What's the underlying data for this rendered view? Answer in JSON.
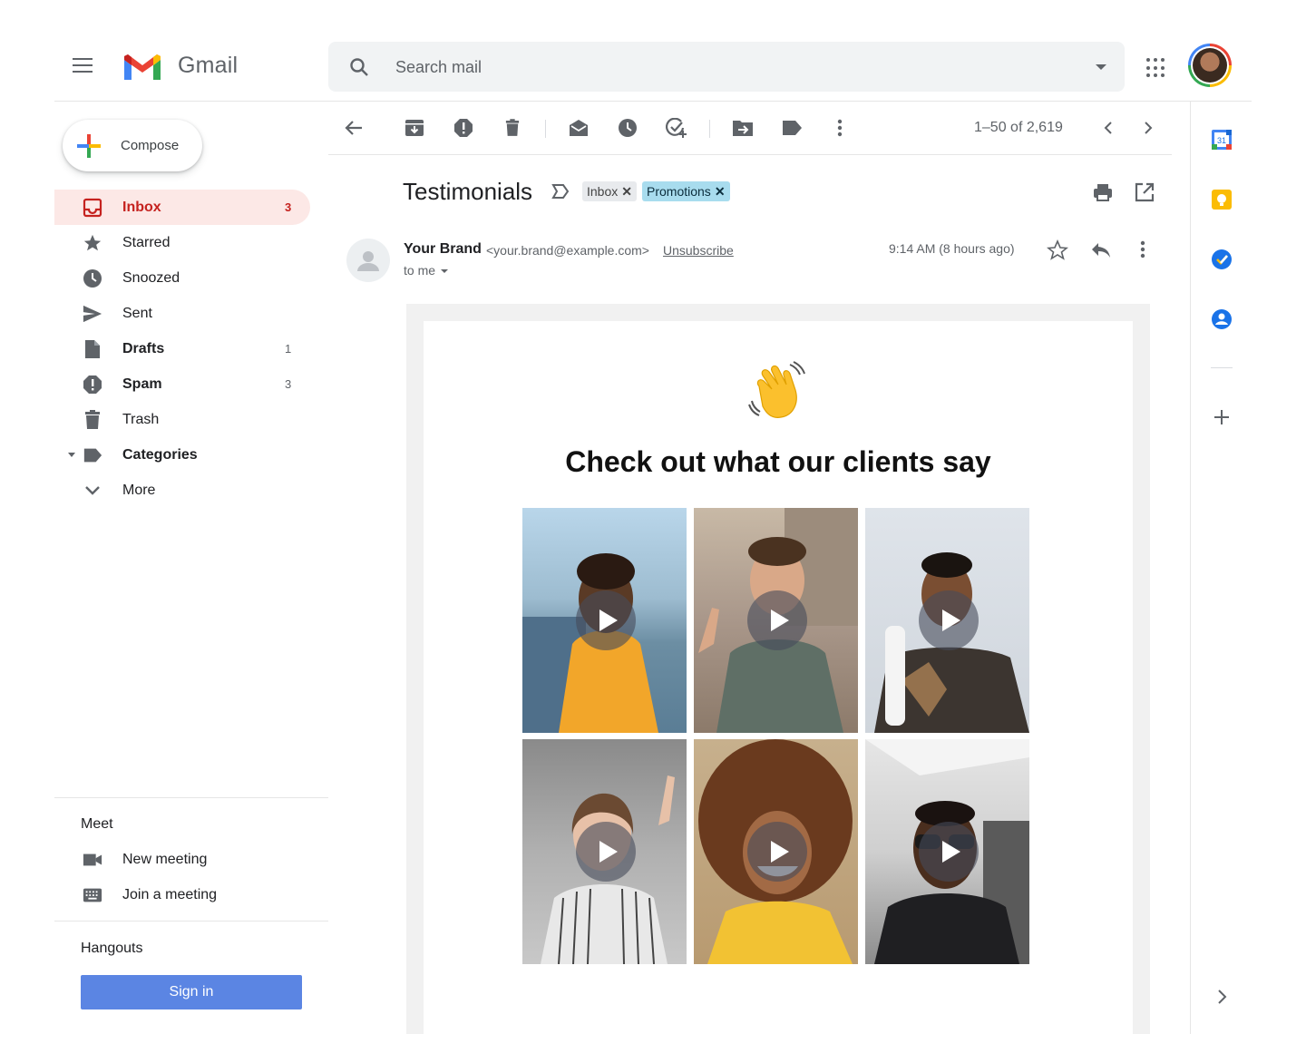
{
  "app": {
    "name": "Gmail"
  },
  "search": {
    "placeholder": "Search mail"
  },
  "compose": {
    "label": "Compose"
  },
  "nav": [
    {
      "label": "Inbox",
      "count": "3",
      "icon": "inbox-icon",
      "bold": true,
      "active": true
    },
    {
      "label": "Starred",
      "count": "",
      "icon": "star-icon"
    },
    {
      "label": "Snoozed",
      "count": "",
      "icon": "clock-icon"
    },
    {
      "label": "Sent",
      "count": "",
      "icon": "send-icon"
    },
    {
      "label": "Drafts",
      "count": "1",
      "icon": "draft-icon",
      "bold": true
    },
    {
      "label": "Spam",
      "count": "3",
      "icon": "spam-icon",
      "bold": true
    },
    {
      "label": "Trash",
      "count": "",
      "icon": "trash-icon"
    },
    {
      "label": "Categories",
      "count": "",
      "icon": "label-icon",
      "bold": true
    },
    {
      "label": "More",
      "count": "",
      "icon": "chevron-down-icon"
    }
  ],
  "meet": {
    "title": "Meet",
    "new_meeting": "New meeting",
    "join_meeting": "Join a meeting"
  },
  "hangouts": {
    "title": "Hangouts",
    "signin": "Sign in"
  },
  "toolbar": {
    "pager": "1–50 of 2,619"
  },
  "message": {
    "subject": "Testimonials",
    "labels": [
      {
        "label": "Inbox"
      },
      {
        "label": "Promotions"
      }
    ],
    "sender_name": "Your Brand",
    "sender_email": "<your.brand@example.com>",
    "unsubscribe": "Unsubscribe",
    "to": "to me",
    "time": "9:14 AM (8 hours ago)"
  },
  "email": {
    "headline": "Check out what our clients say",
    "videos": [
      {
        "name": "video-testimonial-1"
      },
      {
        "name": "video-testimonial-2"
      },
      {
        "name": "video-testimonial-3"
      },
      {
        "name": "video-testimonial-4"
      },
      {
        "name": "video-testimonial-5"
      },
      {
        "name": "video-testimonial-6"
      }
    ]
  },
  "colors": {
    "accent_red": "#c5221f",
    "active_bg": "#fce8e6",
    "signin_blue": "#5b85e3",
    "promo_chip": "#a8dcee"
  }
}
